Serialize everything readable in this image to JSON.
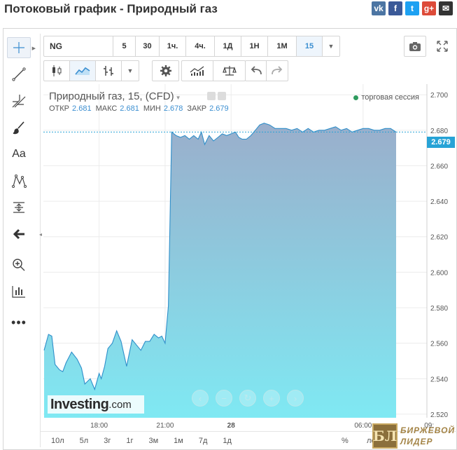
{
  "page": {
    "title": "Потоковый график - Природный газ"
  },
  "share": [
    {
      "name": "vk",
      "label": "vk",
      "color": "#4c75a3"
    },
    {
      "name": "facebook",
      "label": "f",
      "color": "#3b5998"
    },
    {
      "name": "twitter",
      "label": "t",
      "color": "#1da1f2"
    },
    {
      "name": "google-plus",
      "label": "g+",
      "color": "#dd4b39"
    },
    {
      "name": "email",
      "label": "✉",
      "color": "#333333"
    }
  ],
  "toolbar": {
    "symbol": "NG",
    "intervals": [
      "5",
      "30",
      "1ч.",
      "4ч.",
      "1Д",
      "1Н",
      "1М",
      "15"
    ],
    "selected_interval": "15"
  },
  "legend": {
    "instrument": "Природный газ, 15, (CFD)",
    "open_label": "ОТКР",
    "open": "2.681",
    "high_label": "МАКС",
    "high": "2.681",
    "low_label": "МИН",
    "low": "2.678",
    "close_label": "ЗАКР",
    "close": "2.679",
    "session": "торговая сессия"
  },
  "last_price": "2.679",
  "logo": {
    "name": "Investing",
    "suffix": ".com"
  },
  "periods": [
    "10л",
    "5л",
    "3г",
    "1г",
    "3м",
    "1м",
    "7д",
    "1д"
  ],
  "period_percent": "%",
  "period_log": "лог",
  "watermark": {
    "symbol": "БЛ",
    "line1": "БИРЖЕВОЙ",
    "line2": "ЛИДЕР"
  },
  "chart_data": {
    "type": "area",
    "title": "Природный газ, 15, (CFD)",
    "y_ticks": [
      "2.700",
      "2.680",
      "2.660",
      "2.640",
      "2.620",
      "2.600",
      "2.580",
      "2.560",
      "2.540",
      "2.520"
    ],
    "x_ticks": [
      "18:00",
      "21:00",
      "28",
      "06:00",
      "09:"
    ],
    "ylim": [
      2.518,
      2.706
    ],
    "x_unit": "hours from 15:30",
    "x": [
      0.0,
      0.2,
      0.35,
      0.5,
      0.7,
      0.85,
      1.0,
      1.25,
      1.5,
      1.7,
      1.85,
      2.1,
      2.3,
      2.5,
      2.6,
      2.75,
      2.9,
      3.1,
      3.3,
      3.5,
      3.75,
      4.0,
      4.2,
      4.4,
      4.6,
      4.8,
      5.0,
      5.2,
      5.35,
      5.5,
      5.65,
      5.8,
      6.0,
      6.2,
      6.4,
      6.6,
      6.8,
      7.0,
      7.15,
      7.3,
      7.5,
      7.7,
      7.9,
      8.1,
      8.3,
      8.5,
      8.7,
      8.85,
      9.0,
      9.2,
      9.4,
      9.6,
      9.8,
      10.0,
      10.25,
      10.5,
      10.75,
      11.0,
      11.25,
      11.5,
      11.75,
      12.0,
      12.25,
      12.5,
      12.75,
      13.0,
      13.25,
      13.5,
      13.75,
      14.0,
      14.25,
      14.5,
      14.75,
      15.0,
      15.25,
      15.5,
      15.75,
      16.0
    ],
    "values": [
      2.556,
      2.565,
      2.564,
      2.548,
      2.545,
      2.544,
      2.549,
      2.555,
      2.551,
      2.546,
      2.537,
      2.54,
      2.534,
      2.543,
      2.54,
      2.547,
      2.557,
      2.56,
      2.567,
      2.561,
      2.547,
      2.562,
      2.559,
      2.556,
      2.561,
      2.561,
      2.565,
      2.563,
      2.564,
      2.56,
      2.581,
      2.679,
      2.677,
      2.676,
      2.677,
      2.675,
      2.677,
      2.675,
      2.679,
      2.672,
      2.677,
      2.674,
      2.676,
      2.678,
      2.677,
      2.678,
      2.679,
      2.676,
      2.675,
      2.675,
      2.677,
      2.68,
      2.683,
      2.684,
      2.683,
      2.681,
      2.681,
      2.681,
      2.68,
      2.681,
      2.679,
      2.681,
      2.679,
      2.68,
      2.68,
      2.681,
      2.682,
      2.68,
      2.681,
      2.679,
      2.68,
      2.681,
      2.681,
      2.68,
      2.68,
      2.681,
      2.681,
      2.679
    ],
    "last_value": 2.679,
    "grid": true,
    "colors": {
      "line": "#2f8fca",
      "fill_top": "#9aaecb",
      "fill_bottom": "#7fe9f3",
      "last_price": "#27a3d6"
    }
  }
}
